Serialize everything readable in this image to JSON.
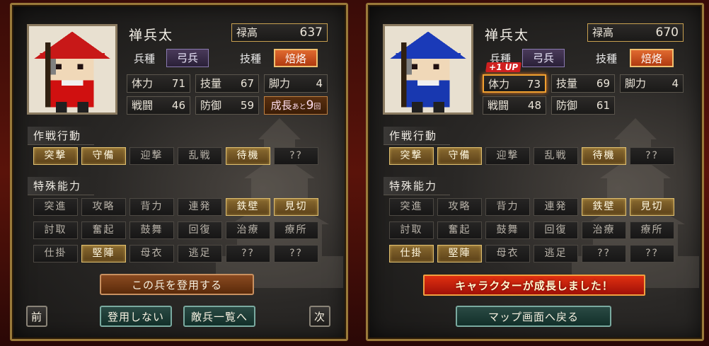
{
  "left": {
    "name": "禅兵太",
    "stipend": {
      "label": "禄高",
      "value": "637"
    },
    "unit_type": {
      "label": "兵種",
      "value": "弓兵"
    },
    "skill": {
      "label": "技種",
      "value": "焙烙"
    },
    "stats": [
      {
        "label": "体力",
        "value": "71"
      },
      {
        "label": "技量",
        "value": "67"
      },
      {
        "label": "脚力",
        "value": "4"
      },
      {
        "label": "戦闘",
        "value": "46"
      },
      {
        "label": "防御",
        "value": "59"
      }
    ],
    "growth": {
      "prefix": "成長",
      "small": "あと",
      "count": "9",
      "suffix": "回"
    },
    "tactics_title": "作戦行動",
    "tactics": [
      {
        "label": "突撃",
        "on": true
      },
      {
        "label": "守備",
        "on": true
      },
      {
        "label": "迎撃",
        "on": false
      },
      {
        "label": "乱戦",
        "on": false
      },
      {
        "label": "待機",
        "on": true
      },
      {
        "label": "??",
        "on": false
      }
    ],
    "abilities_title": "特殊能力",
    "abilities": [
      {
        "label": "突進",
        "on": false
      },
      {
        "label": "攻略",
        "on": false
      },
      {
        "label": "背力",
        "on": false
      },
      {
        "label": "連発",
        "on": false
      },
      {
        "label": "鉄壁",
        "on": true
      },
      {
        "label": "見切",
        "on": true
      },
      {
        "label": "討取",
        "on": false
      },
      {
        "label": "奮起",
        "on": false
      },
      {
        "label": "鼓舞",
        "on": false
      },
      {
        "label": "回復",
        "on": false
      },
      {
        "label": "治療",
        "on": false
      },
      {
        "label": "療所",
        "on": false
      },
      {
        "label": "仕掛",
        "on": false
      },
      {
        "label": "堅陣",
        "on": true
      },
      {
        "label": "母衣",
        "on": false
      },
      {
        "label": "逃足",
        "on": false
      },
      {
        "label": "??",
        "on": false
      },
      {
        "label": "??",
        "on": false
      }
    ],
    "recruit_button": "この兵を登用する",
    "decline_button": "登用しない",
    "enemy_list_button": "敵兵一覧へ",
    "prev_button": "前",
    "next_button": "次",
    "hat_color": "#c81818",
    "robe_color": "#d01010"
  },
  "right": {
    "name": "禅兵太",
    "stipend": {
      "label": "禄高",
      "value": "670"
    },
    "unit_type": {
      "label": "兵種",
      "value": "弓兵"
    },
    "skill": {
      "label": "技種",
      "value": "焙烙"
    },
    "stats": [
      {
        "label": "体力",
        "value": "73"
      },
      {
        "label": "技量",
        "value": "69"
      },
      {
        "label": "脚力",
        "value": "4"
      },
      {
        "label": "戦闘",
        "value": "48"
      },
      {
        "label": "防御",
        "value": "61"
      }
    ],
    "up_badge": "+1 UP",
    "tactics_title": "作戦行動",
    "tactics": [
      {
        "label": "突撃",
        "on": true
      },
      {
        "label": "守備",
        "on": true
      },
      {
        "label": "迎撃",
        "on": false
      },
      {
        "label": "乱戦",
        "on": false
      },
      {
        "label": "待機",
        "on": true
      },
      {
        "label": "??",
        "on": false
      }
    ],
    "abilities_title": "特殊能力",
    "abilities": [
      {
        "label": "突進",
        "on": false
      },
      {
        "label": "攻略",
        "on": false
      },
      {
        "label": "背力",
        "on": false
      },
      {
        "label": "連発",
        "on": false
      },
      {
        "label": "鉄壁",
        "on": true
      },
      {
        "label": "見切",
        "on": true
      },
      {
        "label": "討取",
        "on": false
      },
      {
        "label": "奮起",
        "on": false
      },
      {
        "label": "鼓舞",
        "on": false
      },
      {
        "label": "回復",
        "on": false
      },
      {
        "label": "治療",
        "on": false
      },
      {
        "label": "療所",
        "on": false
      },
      {
        "label": "仕掛",
        "on": true
      },
      {
        "label": "堅陣",
        "on": true
      },
      {
        "label": "母衣",
        "on": false
      },
      {
        "label": "逃足",
        "on": false
      },
      {
        "label": "??",
        "on": false
      },
      {
        "label": "??",
        "on": false
      }
    ],
    "growth_message": "キャラクターが成長しました！",
    "map_button": "マップ画面へ戻る",
    "hat_color": "#1a3ab8",
    "robe_color": "#1838b0"
  }
}
